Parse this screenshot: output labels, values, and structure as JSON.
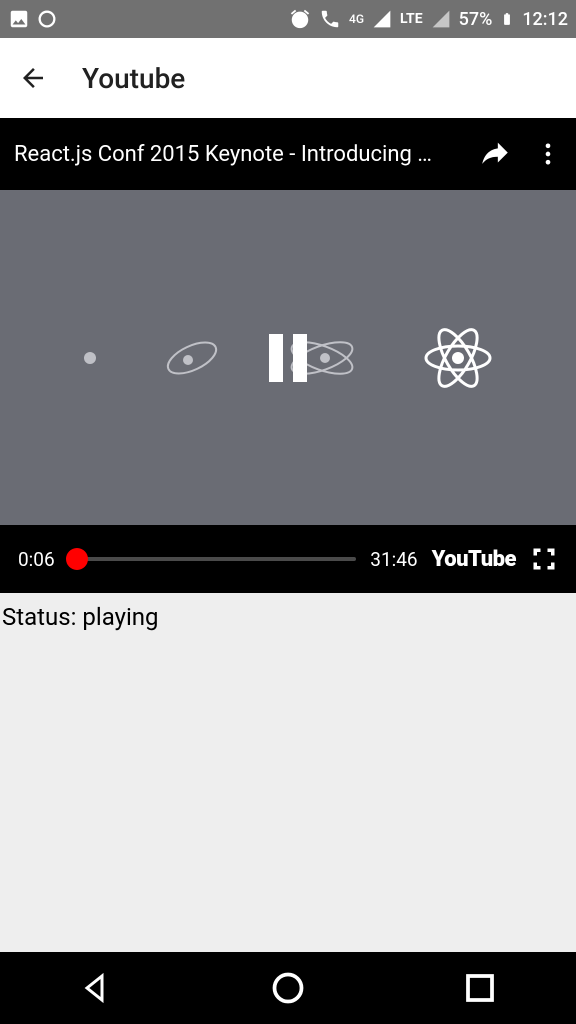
{
  "status_bar": {
    "battery": "57%",
    "time": "12:12",
    "network": "LTE",
    "network2": "4G"
  },
  "app_bar": {
    "title": "Youtube"
  },
  "player": {
    "video_title": "React.js Conf 2015 Keynote - Introducing …",
    "current_time": "0:06",
    "duration": "31:46",
    "logo": "YouTube",
    "progress_percent": 3
  },
  "status": {
    "label": "Status: playing"
  }
}
